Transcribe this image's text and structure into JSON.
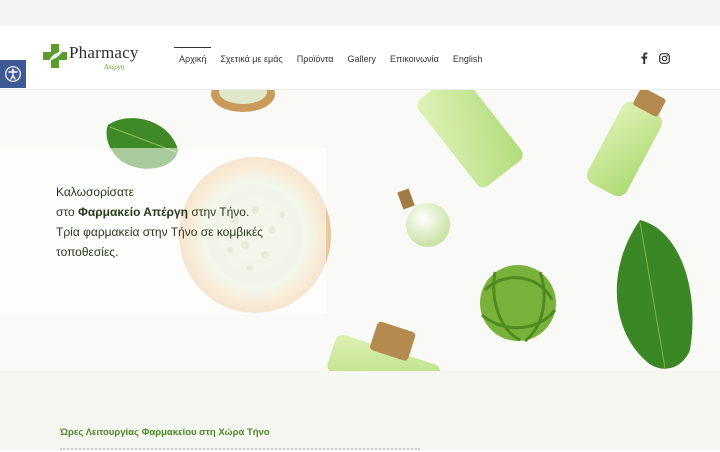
{
  "header": {
    "logo_text": "Pharmacy",
    "logo_sub": "Απέργη",
    "nav": [
      {
        "label": "Αρχική",
        "active": true
      },
      {
        "label": "Σχετικά με εμάς"
      },
      {
        "label": "Προϊόντα"
      },
      {
        "label": "Gallery"
      },
      {
        "label": "Επικοινωνία"
      },
      {
        "label": "English"
      }
    ],
    "social": [
      "facebook-icon",
      "instagram-icon"
    ]
  },
  "hero": {
    "line1": "Καλωσορίσατε",
    "line2_pre": "στο ",
    "line2_bold": "Φαρμακείο Απέργη",
    "line2_post": " στην Τήνο.",
    "line3": "Τρία φαρμακεία στην Τήνο σε κομβικές",
    "line4": "τοποθεσίες."
  },
  "section": {
    "hours_title": "Ώρες Λειτουργίας Φαρμακείου στη Χώρα Τήνο"
  },
  "colors": {
    "brand_green": "#4a8a25",
    "a11y_blue": "#3d5a97"
  }
}
